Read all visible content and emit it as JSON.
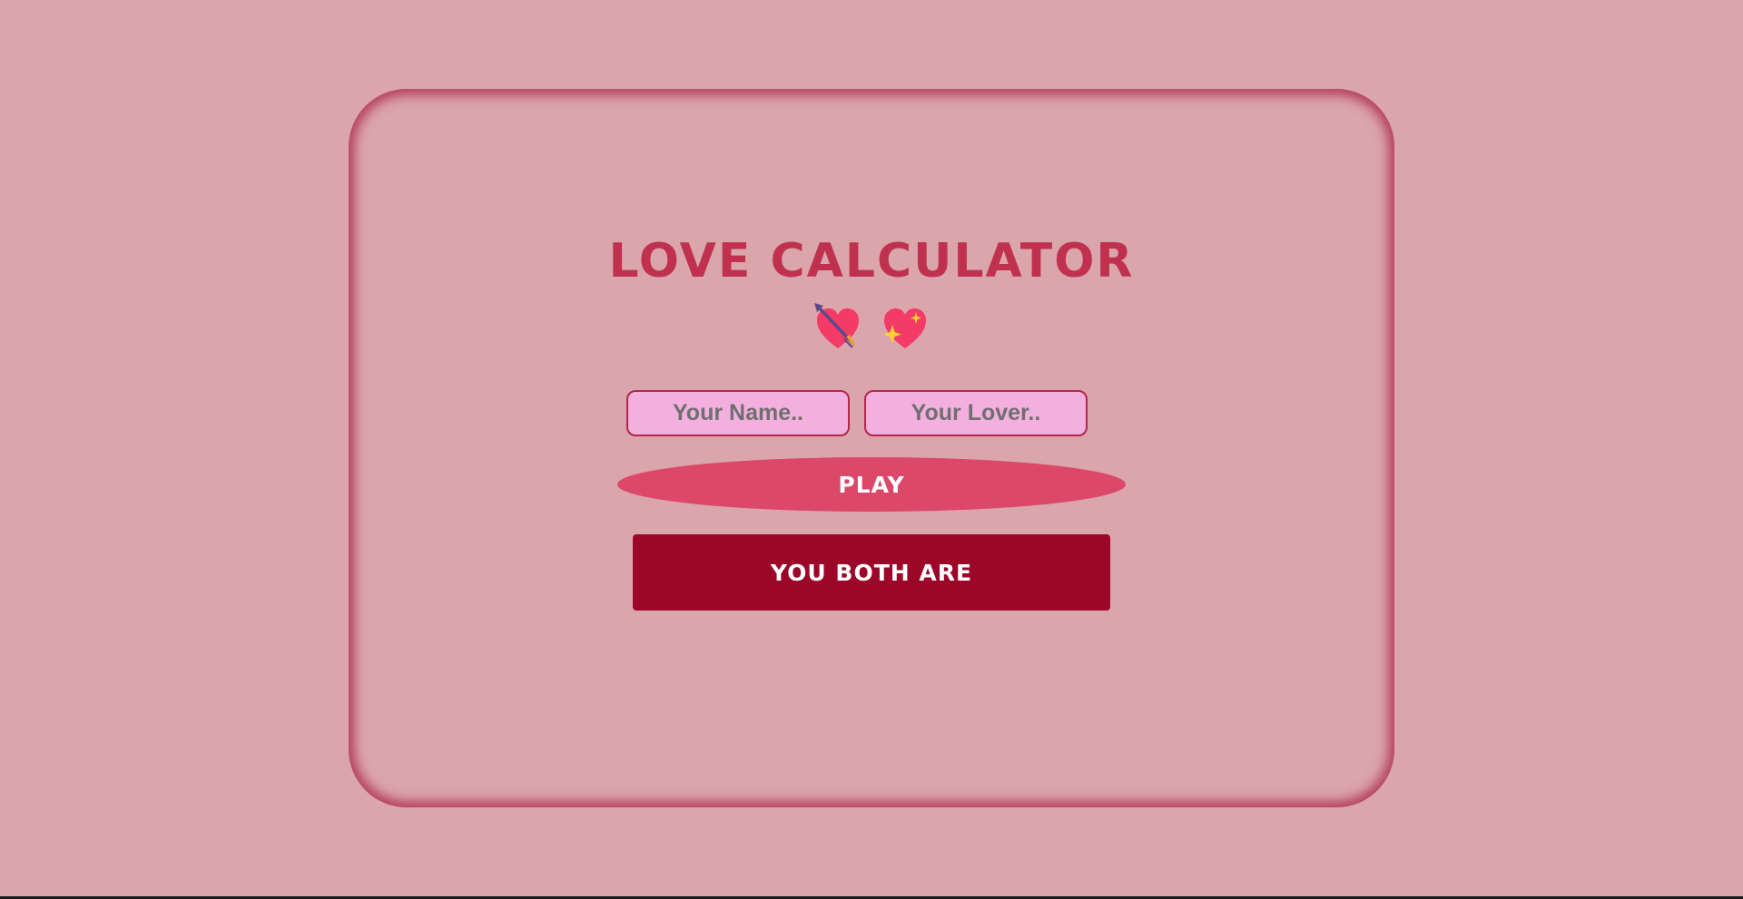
{
  "app": {
    "title": "LOVE CALCULATOR"
  },
  "icons": {
    "first": "heart-with-arrow-icon",
    "second": "sparkling-heart-icon"
  },
  "form": {
    "name_placeholder": "Your Name..",
    "name_value": "",
    "lover_placeholder": "Your Lover..",
    "lover_value": "",
    "play_label": "PLAY"
  },
  "result": {
    "text": "YOU BOTH ARE"
  },
  "colors": {
    "background": "#dba5ac",
    "title": "#c0304f",
    "input_fill": "#f3b0df",
    "input_border": "#b2274a",
    "play_button": "#db4869",
    "result_box": "#9c0628",
    "heart": "#f43a66"
  }
}
